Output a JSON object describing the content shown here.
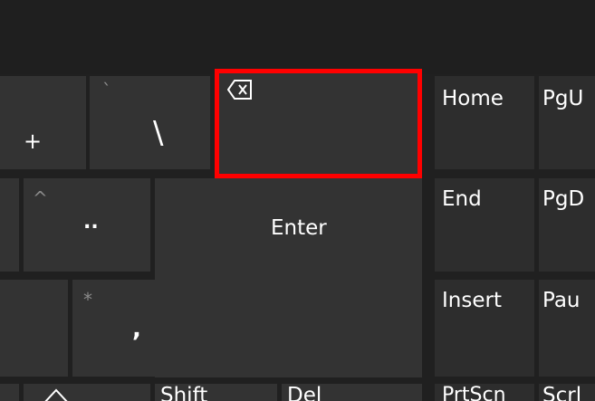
{
  "keyboard": {
    "plus_key": {
      "primary": "+"
    },
    "backslash_key": {
      "secondary": "`",
      "primary": "\\"
    },
    "backspace_key": {
      "icon": "backspace-icon"
    },
    "home_key": {
      "label": "Home"
    },
    "pageup_key": {
      "label": "PgU"
    },
    "colon_key": {
      "secondary": "^",
      "primary": ".."
    },
    "enter_key": {
      "label": "Enter"
    },
    "end_key": {
      "label": "End"
    },
    "pagedown_key": {
      "label": "PgD"
    },
    "comma_key": {
      "secondary": "*",
      "primary": ","
    },
    "insert_key": {
      "label": "Insert"
    },
    "pause_key": {
      "label": "Pau"
    },
    "shift_key": {
      "label": "Shift"
    },
    "del_key": {
      "label": "Del"
    },
    "prtscn_key": {
      "label": "PrtScn"
    },
    "scroll_key": {
      "label": "Scrl"
    },
    "up_arrow_key": {
      "icon": "up-arrow-icon"
    }
  },
  "colors": {
    "key": "#333333",
    "nav_key": "#2d2d2d",
    "background": "#202020",
    "highlight": "#ff0000"
  }
}
